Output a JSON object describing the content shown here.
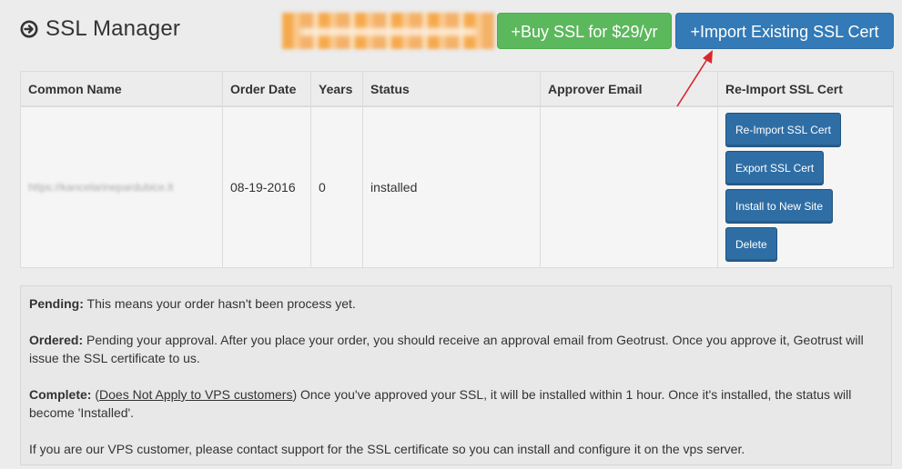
{
  "header": {
    "icon": "circle-arrow-right-icon",
    "title": "SSL Manager"
  },
  "buttons": {
    "buy_label": "+Buy SSL for $29/yr",
    "buy_color": "#5cb85c",
    "import_label": "+Import Existing SSL Cert",
    "import_color": "#337ab7"
  },
  "table": {
    "columns": [
      "Common Name",
      "Order Date",
      "Years",
      "Status",
      "Approver Email",
      "Re-Import SSL Cert"
    ],
    "rows": [
      {
        "common_name": "https://kancelarinepardubice.lt",
        "order_date": "08-19-2016",
        "years": "0",
        "status": "installed",
        "approver_email": "",
        "actions": [
          "Re-Import SSL Cert",
          "Export SSL Cert",
          "Install to New Site",
          "Delete"
        ]
      }
    ]
  },
  "info": {
    "pending_label": "Pending:",
    "pending_text": " This means your order hasn't been process yet.",
    "ordered_label": "Ordered:",
    "ordered_text": " Pending your approval. After you place your order, you should receive an approval email from Geotrust. Once you approve it, Geotrust will issue the SSL certificate to us.",
    "complete_label": "Complete:",
    "complete_open": " (",
    "complete_link": "Does Not Apply to VPS customers",
    "complete_text": ") Once you've approved your SSL, it will be installed within 1 hour. Once it's installed, the status will become 'Installed'.",
    "vps_text": "If you are our VPS customer, please contact support for the SSL certificate so you can install and configure it on the vps server."
  }
}
